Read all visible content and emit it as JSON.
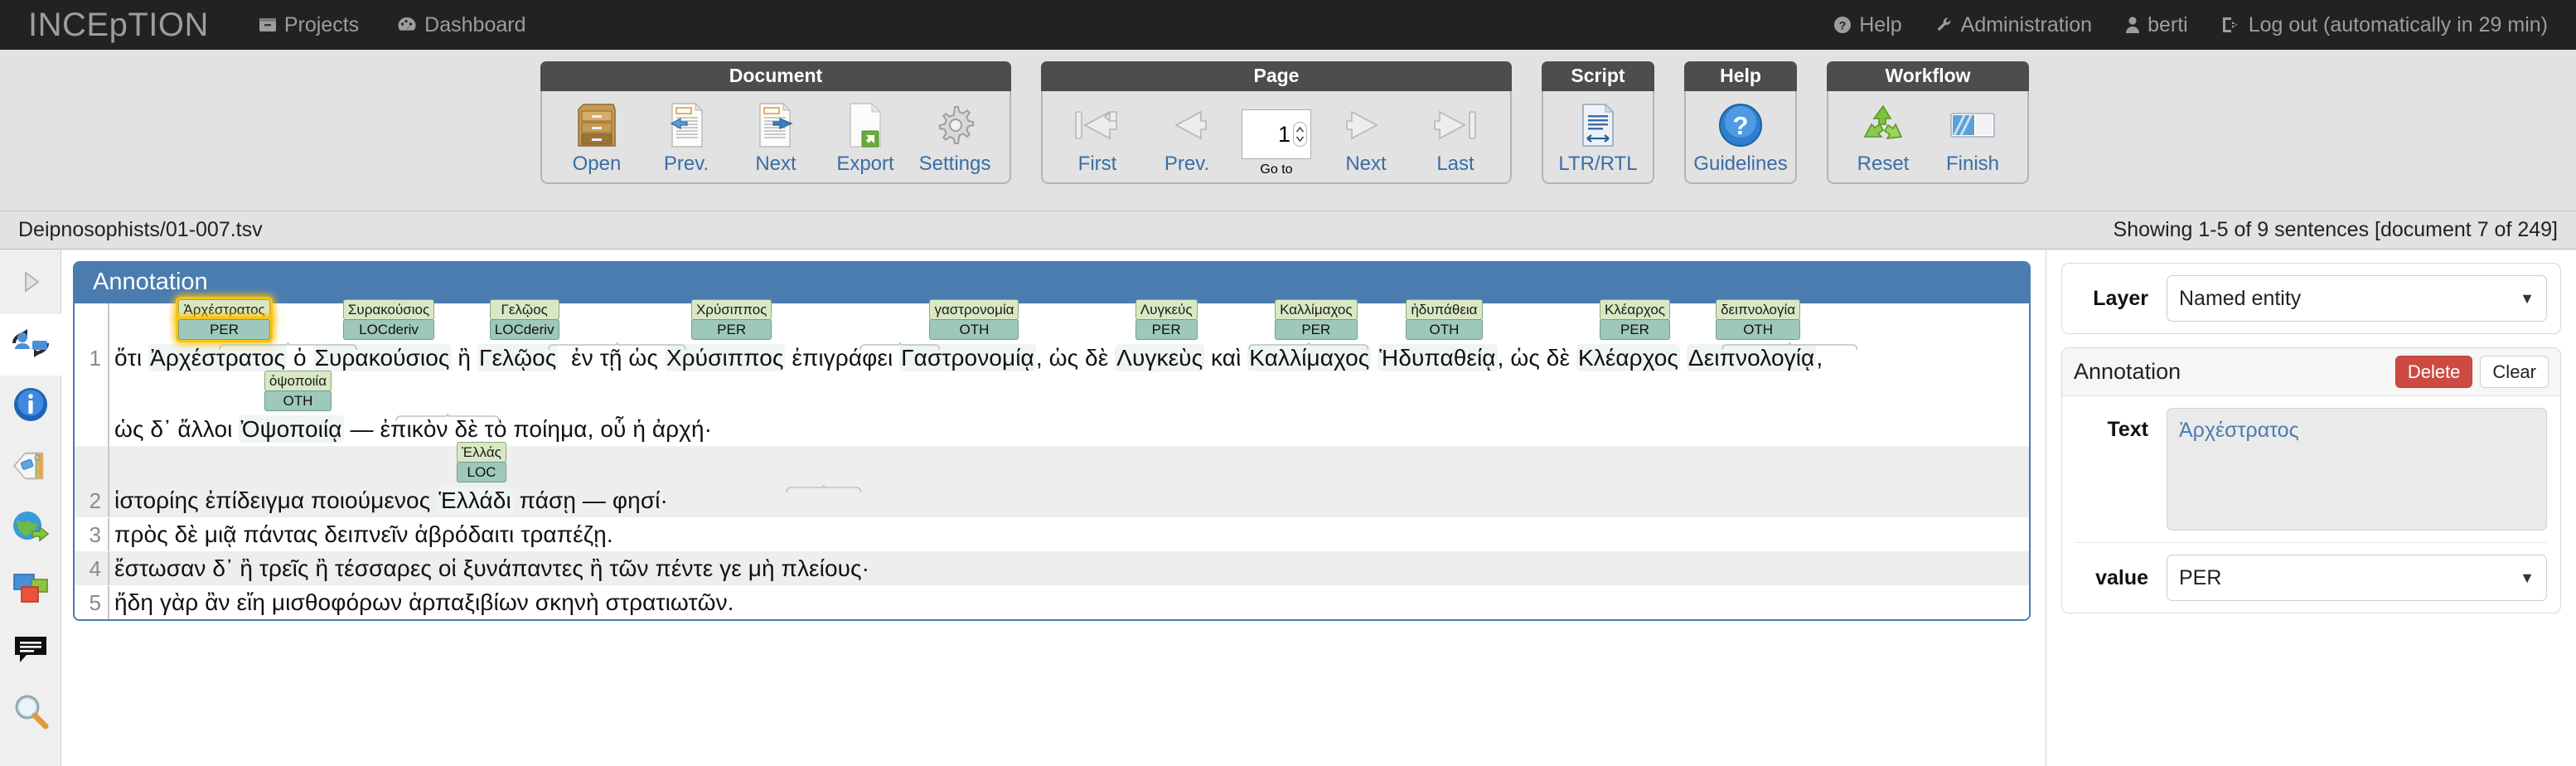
{
  "topnav": {
    "brand": "INCEpTION",
    "left_links": [
      {
        "label": "Projects",
        "icon": "projects-icon"
      },
      {
        "label": "Dashboard",
        "icon": "dashboard-icon"
      }
    ],
    "right_links": [
      {
        "label": "Help",
        "icon": "help-circle-icon"
      },
      {
        "label": "Administration",
        "icon": "wrench-icon"
      },
      {
        "label": "berti",
        "icon": "user-icon"
      },
      {
        "label": "Log out (automatically in 29 min)",
        "icon": "logout-icon"
      }
    ]
  },
  "toolbar": {
    "groups": [
      {
        "title": "Document",
        "tools": [
          {
            "label": "Open",
            "icon": "cabinet-icon"
          },
          {
            "label": "Prev.",
            "icon": "document-prev-icon"
          },
          {
            "label": "Next",
            "icon": "document-next-icon"
          },
          {
            "label": "Export",
            "icon": "export-icon"
          },
          {
            "label": "Settings",
            "icon": "gear-icon"
          }
        ]
      },
      {
        "title": "Page",
        "tools": [
          {
            "label": "First",
            "icon": "first-page-icon"
          },
          {
            "label": "Prev.",
            "icon": "prev-page-icon"
          },
          {
            "label": "Go to",
            "icon": "page-number-input",
            "value": "1"
          },
          {
            "label": "Next",
            "icon": "next-page-icon"
          },
          {
            "label": "Last",
            "icon": "last-page-icon"
          }
        ]
      },
      {
        "title": "Script",
        "tools": [
          {
            "label": "LTR/RTL",
            "icon": "text-direction-icon"
          }
        ]
      },
      {
        "title": "Help",
        "tools": [
          {
            "label": "Guidelines",
            "icon": "question-circle-icon"
          }
        ]
      },
      {
        "title": "Workflow",
        "tools": [
          {
            "label": "Reset",
            "icon": "recycle-icon"
          },
          {
            "label": "Finish",
            "icon": "finish-icon"
          }
        ]
      }
    ]
  },
  "docbar": {
    "path": "Deipnosophists/01-007.tsv",
    "status": "Showing 1-5 of 9 sentences [document 7 of 249]"
  },
  "rail": {
    "items": [
      {
        "name": "expand-panel-icon"
      },
      {
        "name": "curation-sync-icon"
      },
      {
        "name": "info-icon"
      },
      {
        "name": "tags-icon"
      },
      {
        "name": "globe-export-icon"
      },
      {
        "name": "layers-icon"
      },
      {
        "name": "comment-icon"
      },
      {
        "name": "search-icon"
      }
    ]
  },
  "editor": {
    "title": "Annotation",
    "sentences": [
      {
        "number": "1",
        "lines": [
          {
            "segments": [
              {
                "text": "ὅτι ",
                "entity": false
              },
              {
                "text": "Ἀρχέστρατος",
                "entity": true,
                "label_top": "Ἀρχέστρατος",
                "label_bottom": "PER",
                "selected": true
              },
              {
                "text": " ὁ ",
                "entity": false
              },
              {
                "text": "Συρακούσιος",
                "entity": true,
                "label_top": "Συρακούσιος",
                "label_bottom": "LOCderiv",
                "selected": false
              },
              {
                "text": " ἢ ",
                "entity": false
              },
              {
                "text": "Γελῷος",
                "entity": true,
                "label_top": "Γελῷος",
                "label_bottom": "LOCderiv",
                "selected": false
              },
              {
                "text": "  ἐν τῇ ὡς ",
                "entity": false
              },
              {
                "text": "Χρύσιππος",
                "entity": true,
                "label_top": "Χρύσιππος",
                "label_bottom": "PER",
                "selected": false
              },
              {
                "text": " ἐπιγράφει ",
                "entity": false
              },
              {
                "text": "Γαστρονομίᾳ",
                "entity": true,
                "label_top": "γαστρονομία",
                "label_bottom": "OTH",
                "selected": false
              },
              {
                "text": ", ὡς δὲ ",
                "entity": false
              },
              {
                "text": "Λυγκεὺς",
                "entity": true,
                "label_top": "Λυγκεύς",
                "label_bottom": "PER",
                "selected": false
              },
              {
                "text": " καὶ ",
                "entity": false
              },
              {
                "text": "Καλλίμαχος",
                "entity": true,
                "label_top": "Καλλίμαχος",
                "label_bottom": "PER",
                "selected": false
              },
              {
                "text": " ",
                "entity": false
              },
              {
                "text": "Ἡδυπαθείᾳ",
                "entity": true,
                "label_top": "ἡδυπάθεια",
                "label_bottom": "OTH",
                "selected": false
              },
              {
                "text": ", ὡς δὲ ",
                "entity": false
              },
              {
                "text": "Κλέαρχος",
                "entity": true,
                "label_top": "Κλέαρχος",
                "label_bottom": "PER",
                "selected": false
              },
              {
                "text": " ",
                "entity": false
              },
              {
                "text": "Δειπνολογίᾳ",
                "entity": true,
                "label_top": "δειπνολογία",
                "label_bottom": "OTH",
                "selected": false
              },
              {
                "text": ",",
                "entity": false
              }
            ]
          },
          {
            "segments": [
              {
                "text": "ὡς δ᾽ ἄλλοι ",
                "entity": false
              },
              {
                "text": "Ὀψοποιίᾳ",
                "entity": true,
                "label_top": "ὀψοποιία",
                "label_bottom": "OTH",
                "selected": false
              },
              {
                "text": " — ἐπικὸν δὲ τὸ ποίημα, οὗ ἡ ἀρχή·",
                "entity": false
              }
            ]
          }
        ]
      },
      {
        "number": "2",
        "lines": [
          {
            "segments": [
              {
                "text": "ἱστορίης ἐπίδειγμα ποιούμενος ",
                "entity": false
              },
              {
                "text": "Ἑλλάδι",
                "entity": true,
                "label_top": "Ἑλλάς",
                "label_bottom": "LOC",
                "selected": false
              },
              {
                "text": " πάσῃ — φησί·",
                "entity": false
              }
            ]
          }
        ]
      },
      {
        "number": "3",
        "lines": [
          {
            "segments": [
              {
                "text": "πρὸς δὲ μιᾷ πάντας δειπνεῖν ἁβρόδαιτι τραπέζῃ.",
                "entity": false
              }
            ]
          }
        ]
      },
      {
        "number": "4",
        "lines": [
          {
            "segments": [
              {
                "text": "ἔστωσαν δ᾽ ἢ τρεῖς ἢ τέσσαρες οἱ ξυνάπαντες ἢ τῶν πέντε γε μὴ πλείους·",
                "entity": false
              }
            ]
          }
        ]
      },
      {
        "number": "5",
        "lines": [
          {
            "segments": [
              {
                "text": "ἤδη γὰρ ἂν εἴη μισθοφόρων ἁρπαξιβίων σκηνὴ στρατιωτῶν.",
                "entity": false
              }
            ]
          }
        ]
      }
    ]
  },
  "sidepanel": {
    "layer_label": "Layer",
    "layer_value": "Named entity",
    "annotation_title": "Annotation",
    "delete_label": "Delete",
    "clear_label": "Clear",
    "text_label": "Text",
    "text_value": "Ἀρχέστρατος",
    "value_label": "value",
    "value_value": "PER"
  },
  "colors": {
    "brand_bar": "#222222",
    "editor_header": "#4a7cb0",
    "label_top": "#d9e8c4",
    "label_bottom": "#9fc8bc",
    "selection_glow": "#ffc30b",
    "delete_button": "#cd4a43",
    "link_blue": "#3a6ea5"
  }
}
